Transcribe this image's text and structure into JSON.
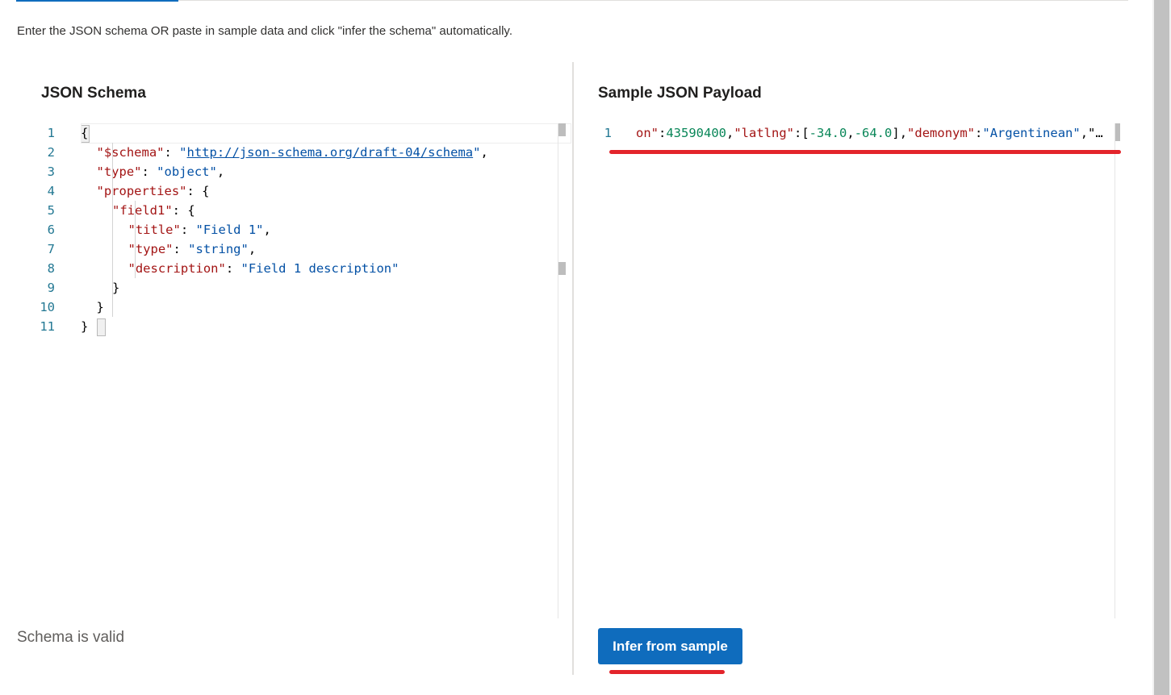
{
  "intro": "Enter the JSON schema OR paste in sample data and click \"infer the schema\" automatically.",
  "schema_panel": {
    "title": "JSON Schema",
    "line_numbers": [
      "1",
      "2",
      "3",
      "4",
      "5",
      "6",
      "7",
      "8",
      "9",
      "10",
      "11"
    ],
    "lines": [
      [
        {
          "t": "p",
          "v": "{"
        }
      ],
      [
        {
          "t": "k",
          "v": "\"$schema\""
        },
        {
          "t": "p",
          "v": ": "
        },
        {
          "t": "s",
          "v": "\""
        },
        {
          "t": "url",
          "v": "http://json-schema.org/draft-04/schema"
        },
        {
          "t": "s",
          "v": "\""
        },
        {
          "t": "p",
          "v": ","
        }
      ],
      [
        {
          "t": "k",
          "v": "\"type\""
        },
        {
          "t": "p",
          "v": ": "
        },
        {
          "t": "s",
          "v": "\"object\""
        },
        {
          "t": "p",
          "v": ","
        }
      ],
      [
        {
          "t": "k",
          "v": "\"properties\""
        },
        {
          "t": "p",
          "v": ": {"
        }
      ],
      [
        {
          "t": "k",
          "v": "\"field1\""
        },
        {
          "t": "p",
          "v": ": {"
        }
      ],
      [
        {
          "t": "k",
          "v": "\"title\""
        },
        {
          "t": "p",
          "v": ": "
        },
        {
          "t": "s",
          "v": "\"Field 1\""
        },
        {
          "t": "p",
          "v": ","
        }
      ],
      [
        {
          "t": "k",
          "v": "\"type\""
        },
        {
          "t": "p",
          "v": ": "
        },
        {
          "t": "s",
          "v": "\"string\""
        },
        {
          "t": "p",
          "v": ","
        }
      ],
      [
        {
          "t": "k",
          "v": "\"description\""
        },
        {
          "t": "p",
          "v": ": "
        },
        {
          "t": "s",
          "v": "\"Field 1 description\""
        }
      ],
      [
        {
          "t": "p",
          "v": "}"
        }
      ],
      [
        {
          "t": "p",
          "v": "}"
        }
      ],
      [
        {
          "t": "p",
          "v": "}"
        }
      ]
    ],
    "indent_levels": [
      0,
      1,
      1,
      1,
      2,
      3,
      3,
      3,
      2,
      1,
      0
    ]
  },
  "sample_panel": {
    "title": "Sample JSON Payload",
    "line_numbers": [
      "1"
    ],
    "lines": [
      [
        {
          "t": "k",
          "v": "on\""
        },
        {
          "t": "p",
          "v": ":"
        },
        {
          "t": "n",
          "v": "43590400"
        },
        {
          "t": "p",
          "v": ","
        },
        {
          "t": "k",
          "v": "\"latlng\""
        },
        {
          "t": "p",
          "v": ":["
        },
        {
          "t": "n",
          "v": "-34.0"
        },
        {
          "t": "p",
          "v": ","
        },
        {
          "t": "n",
          "v": "-64.0"
        },
        {
          "t": "p",
          "v": "],"
        },
        {
          "t": "k",
          "v": "\"demonym\""
        },
        {
          "t": "p",
          "v": ":"
        },
        {
          "t": "s",
          "v": "\"Argentinean\""
        },
        {
          "t": "p",
          "v": ",\"…"
        }
      ]
    ]
  },
  "status": "Schema is valid",
  "infer_button": "Infer from sample",
  "colors": {
    "accent": "#0f6cbd",
    "annotation": "#e3242b"
  }
}
